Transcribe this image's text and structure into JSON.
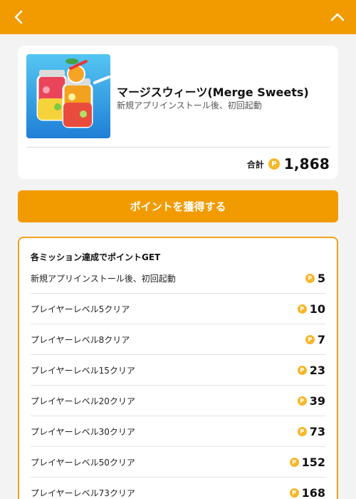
{
  "colors": {
    "accent": "#f29b00",
    "coin": "#f5b82b",
    "border": "#f0a21b"
  },
  "header": {
    "back_icon": "chevron-left-icon",
    "collapse_icon": "chevron-up-icon"
  },
  "app": {
    "name": "マージスウィーツ(Merge Sweets)",
    "condition": "新規アプリインストール後、初回起動",
    "total_label": "合計",
    "total_points": "1,868",
    "coin_glyph": "P"
  },
  "cta": {
    "label": "ポイントを獲得する"
  },
  "missions": {
    "heading": "各ミッション達成でポイントGET",
    "items": [
      {
        "label": "新規アプリインストール後、初回起動",
        "points": "5"
      },
      {
        "label": "プレイヤーレベル5クリア",
        "points": "10"
      },
      {
        "label": "プレイヤーレベル8クリア",
        "points": "7"
      },
      {
        "label": "プレイヤーレベル15クリア",
        "points": "23"
      },
      {
        "label": "プレイヤーレベル20クリア",
        "points": "39"
      },
      {
        "label": "プレイヤーレベル30クリア",
        "points": "73"
      },
      {
        "label": "プレイヤーレベル50クリア",
        "points": "152"
      },
      {
        "label": "プレイヤーレベル73クリア",
        "points": "168"
      }
    ]
  }
}
